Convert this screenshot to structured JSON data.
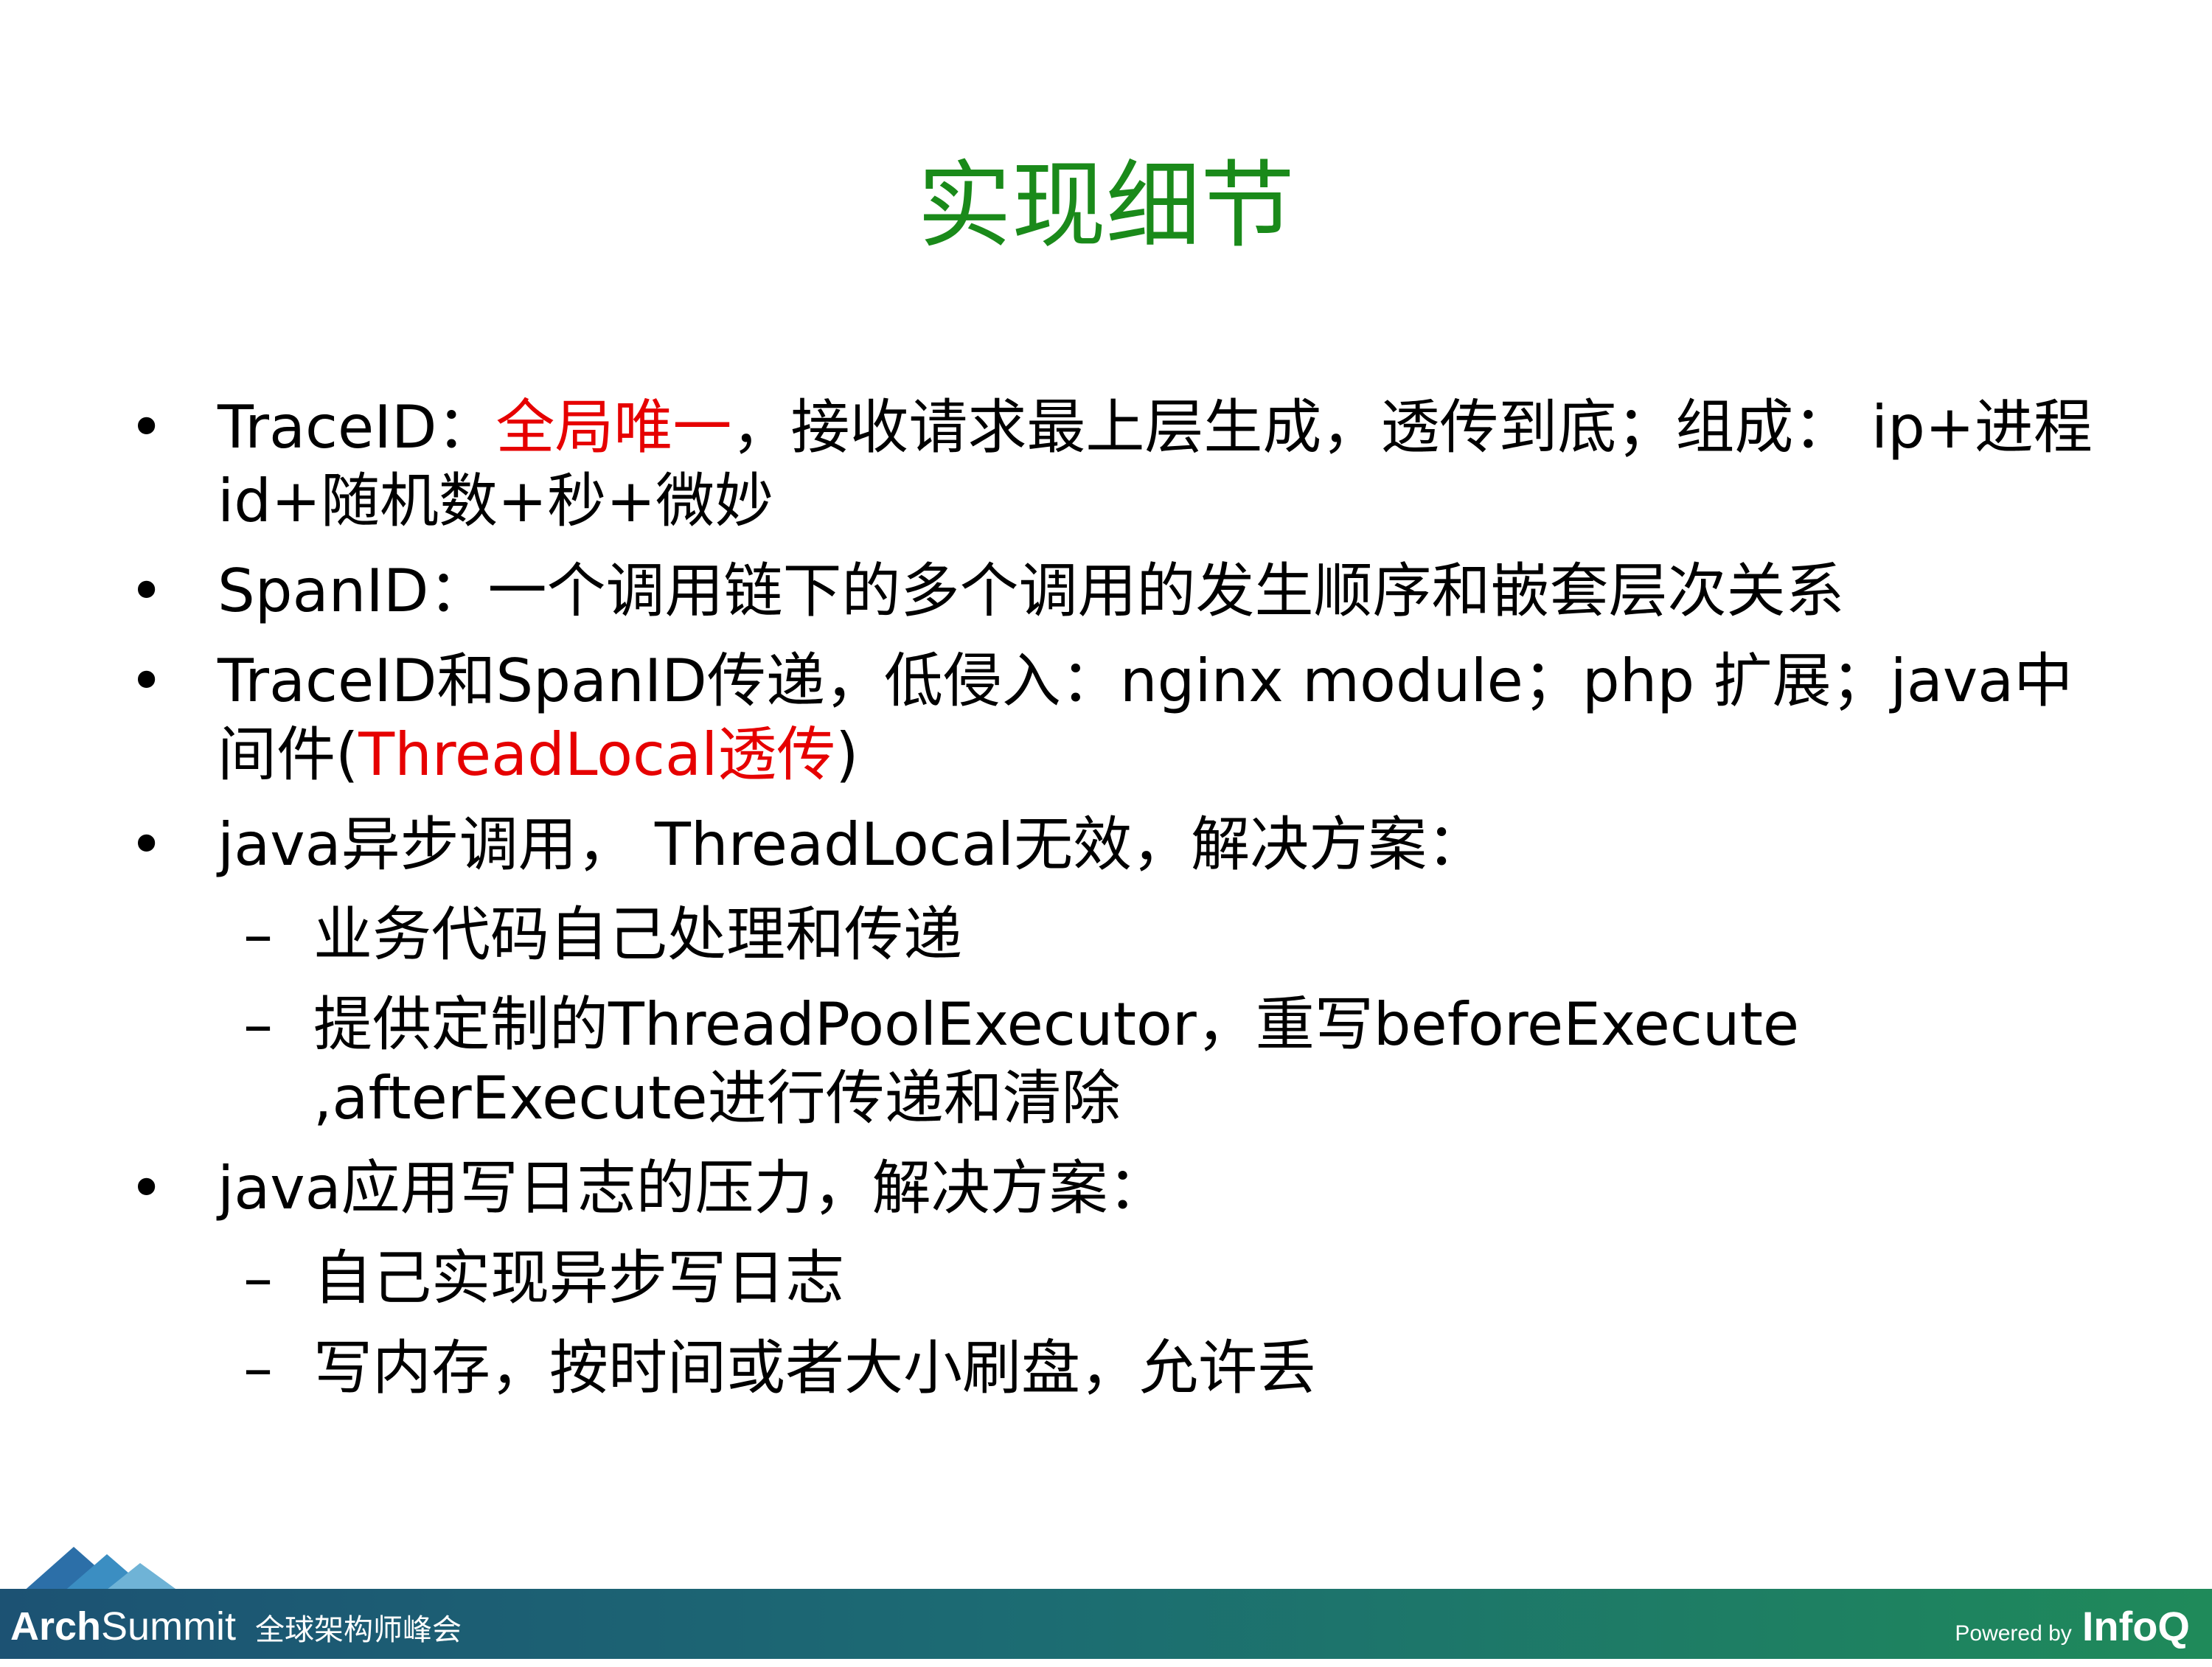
{
  "title": "实现细节",
  "colors": {
    "title": "#1a8a1a",
    "highlight": "#e60000",
    "footer_start": "#1c5273",
    "footer_end": "#1f8a5a"
  },
  "bullet_marker": "•",
  "sub_marker": "–",
  "items": [
    {
      "segments": [
        "TraceID：",
        "全局唯一",
        "，接收请求最上层生成，透传到底；组成： ip+进程id+随机数+秒+微妙"
      ]
    },
    {
      "text": "SpanID：一个调用链下的多个调用的发生顺序和嵌套层次关系"
    },
    {
      "segments": [
        "TraceID和SpanID传递，低侵入：nginx module；php 扩展；java中间件(",
        "ThreadLocal透传",
        ")"
      ]
    },
    {
      "text": "java异步调用， ThreadLocal无效，解决方案："
    },
    {
      "text": "业务代码自己处理和传递"
    },
    {
      "text": "提供定制的ThreadPoolExecutor，重写beforeExecute ,afterExecute进行传递和清除"
    },
    {
      "text": "java应用写日志的压力，解决方案："
    },
    {
      "text": "自己实现异步写日志"
    },
    {
      "text": "写内存，按时间或者大小刷盘，允许丢"
    }
  ],
  "footer": {
    "brand_bold": "Arch",
    "brand_regular": "Summit",
    "brand_cn": "全球架构师峰会",
    "powered_by": "Powered by",
    "infoq": "InfoQ"
  }
}
